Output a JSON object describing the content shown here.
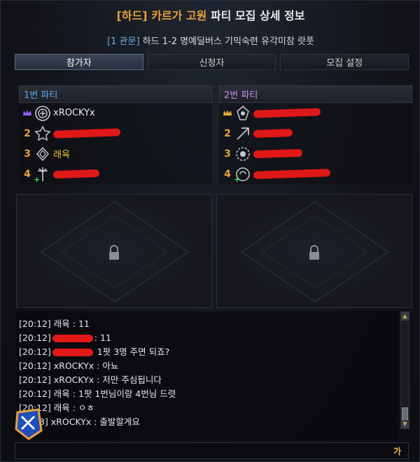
{
  "header": {
    "difficulty_tag": "[하드]",
    "raid_name": "카르가 고원",
    "title_suffix": "파티 모집 상세 정보",
    "stage": "[1 관문]",
    "description": "하드 1-2 명예딜버스 기믹숙련 유각미참 랏풋"
  },
  "tabs": [
    {
      "label": "참가자",
      "active": true
    },
    {
      "label": "신청자",
      "active": false
    },
    {
      "label": "모집 설정",
      "active": false
    }
  ],
  "parties": [
    {
      "title": "1번 파티",
      "members": [
        {
          "slot": "",
          "leader": true,
          "name": "xROCKYx",
          "icon": "class-emblem-icon"
        },
        {
          "slot": "2",
          "leader": false,
          "name": "",
          "icon": "class-emblem-icon"
        },
        {
          "slot": "3",
          "leader": false,
          "name": "래육",
          "icon": "class-emblem-icon"
        },
        {
          "slot": "4",
          "leader": false,
          "name": "",
          "icon": "support-emblem-icon"
        }
      ]
    },
    {
      "title": "2번 파티",
      "members": [
        {
          "slot": "",
          "leader": true,
          "name": "",
          "icon": "class-emblem-icon"
        },
        {
          "slot": "2",
          "leader": false,
          "name": "",
          "icon": "class-emblem-icon"
        },
        {
          "slot": "3",
          "leader": false,
          "name": "",
          "icon": "class-emblem-icon"
        },
        {
          "slot": "4",
          "leader": false,
          "name": "",
          "icon": "support-emblem-icon"
        }
      ]
    }
  ],
  "chat": [
    {
      "time": "[20:12]",
      "sender": "래육",
      "message": "11"
    },
    {
      "time": "[20:12]",
      "sender": "",
      "message": "11"
    },
    {
      "time": "[20:12]",
      "sender": "",
      "message": "1팟 3명 주면 되죠?"
    },
    {
      "time": "[20:12]",
      "sender": "xROCKYx",
      "message": "아뇨"
    },
    {
      "time": "[20:12]",
      "sender": "xROCKYx",
      "message": "저만 주심됩니다"
    },
    {
      "time": "[20:12]",
      "sender": "래육",
      "message": "1팟 1번님이랑 4번님 드렷"
    },
    {
      "time": "[20:12]",
      "sender": "래육",
      "message": "ㅇㅎ"
    },
    {
      "time": "[2 :13]",
      "sender": "xROCKYx",
      "message": "출발할게요"
    }
  ],
  "input": {
    "lang_indicator": "가"
  },
  "icons": {
    "locked_slot": "lock-icon",
    "leader": "crown-icon"
  },
  "colors": {
    "accent_gold": "#e9a23b",
    "party1": "#5ea8ef",
    "party2": "#c78ff0",
    "redaction": "#e01818"
  }
}
